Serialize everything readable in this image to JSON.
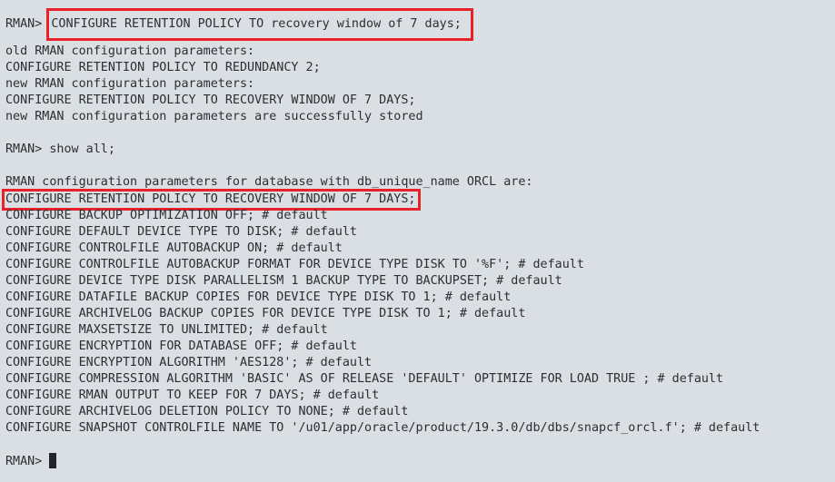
{
  "terminal": {
    "prompt": "RMAN> ",
    "command1": "CONFIGURE RETENTION POLICY TO recovery window of 7 days;",
    "block1": [
      "old RMAN configuration parameters:",
      "CONFIGURE RETENTION POLICY TO REDUNDANCY 2;",
      "new RMAN configuration parameters:",
      "CONFIGURE RETENTION POLICY TO RECOVERY WINDOW OF 7 DAYS;",
      "new RMAN configuration parameters are successfully stored"
    ],
    "command2": "show all;",
    "show_all_header": "RMAN configuration parameters for database with db_unique_name ORCL are:",
    "highlighted_line": "CONFIGURE RETENTION POLICY TO RECOVERY WINDOW OF 7 DAYS;",
    "config_lines": [
      "CONFIGURE BACKUP OPTIMIZATION OFF; # default",
      "CONFIGURE DEFAULT DEVICE TYPE TO DISK; # default",
      "CONFIGURE CONTROLFILE AUTOBACKUP ON; # default",
      "CONFIGURE CONTROLFILE AUTOBACKUP FORMAT FOR DEVICE TYPE DISK TO '%F'; # default",
      "CONFIGURE DEVICE TYPE DISK PARALLELISM 1 BACKUP TYPE TO BACKUPSET; # default",
      "CONFIGURE DATAFILE BACKUP COPIES FOR DEVICE TYPE DISK TO 1; # default",
      "CONFIGURE ARCHIVELOG BACKUP COPIES FOR DEVICE TYPE DISK TO 1; # default",
      "CONFIGURE MAXSETSIZE TO UNLIMITED; # default",
      "CONFIGURE ENCRYPTION FOR DATABASE OFF; # default",
      "CONFIGURE ENCRYPTION ALGORITHM 'AES128'; # default",
      "CONFIGURE COMPRESSION ALGORITHM 'BASIC' AS OF RELEASE 'DEFAULT' OPTIMIZE FOR LOAD TRUE ; # default",
      "CONFIGURE RMAN OUTPUT TO KEEP FOR 7 DAYS; # default",
      "CONFIGURE ARCHIVELOG DELETION POLICY TO NONE; # default",
      "CONFIGURE SNAPSHOT CONTROLFILE NAME TO '/u01/app/oracle/product/19.3.0/db/dbs/snapcf_orcl.f'; # default"
    ],
    "highlight_color": "#e8212b",
    "background_color": "#dadfe3"
  }
}
